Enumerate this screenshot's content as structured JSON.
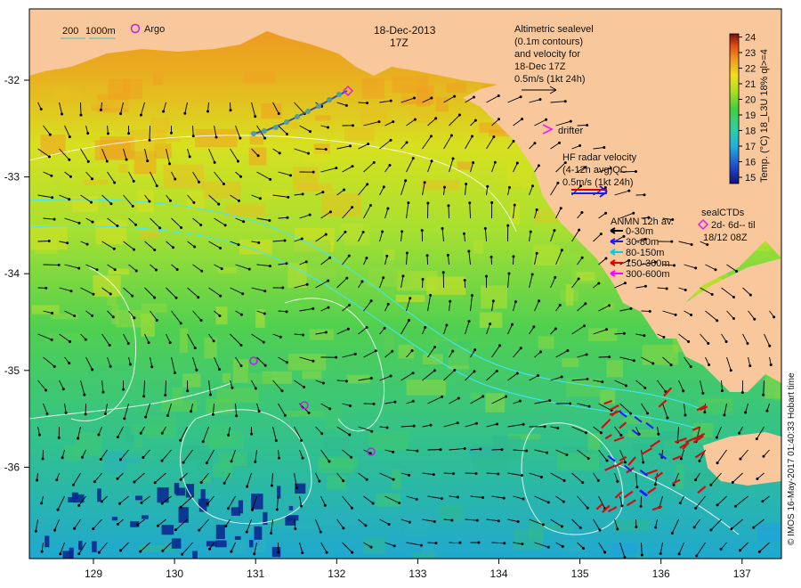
{
  "map": {
    "date_title": "18-Dec-2013",
    "time_title": "17Z",
    "x_ticks": [
      129,
      130,
      131,
      132,
      133,
      134,
      135,
      136,
      137
    ],
    "y_ticks": [
      -32,
      -33,
      -34,
      -35,
      -36
    ],
    "bathy_legend": {
      "label_200": "200",
      "label_1000": "1000m"
    },
    "argo_label": "Argo",
    "altimetric": {
      "lines": [
        "Altimetric sealevel",
        "(0.1m contours)",
        "and velocity for",
        "18-Dec 17Z",
        "0.5m/s (1kt 24h)"
      ]
    },
    "drifter_label": "drifter",
    "hf_radar": {
      "lines": [
        "HF radar velocity",
        "(4-12h avg)QC",
        "0.5m/s (1kt 24h)"
      ]
    },
    "anmn": {
      "title": "ANMN 12h av.",
      "items": [
        {
          "label": "0-30m",
          "color": "#000000"
        },
        {
          "label": "30-80m",
          "color": "#1a1aff"
        },
        {
          "label": "80-150m",
          "color": "#00d0e0"
        },
        {
          "label": "150-300m",
          "color": "#e00000"
        },
        {
          "label": "300-600m",
          "color": "#ff00ff"
        }
      ]
    },
    "seal_ctds": {
      "title": "sealCTDs",
      "line1": "2d- 6d-- til",
      "line2": "18/12 08Z"
    },
    "colorbar": {
      "label": "Temp. (°C) 18_L3U 18% ql>=4",
      "ticks": [
        15,
        16,
        17,
        18,
        19,
        20,
        21,
        22,
        23,
        24
      ],
      "min": 14.6,
      "max": 24.2
    },
    "credit": "© IMOS 16-May-2017 01:40:33 Hobart time",
    "colors": {
      "land": "#f8c89c",
      "warm": "#f08a20",
      "mid": "#c8e020",
      "cool": "#20c870",
      "cold": "#20a0e0"
    }
  }
}
